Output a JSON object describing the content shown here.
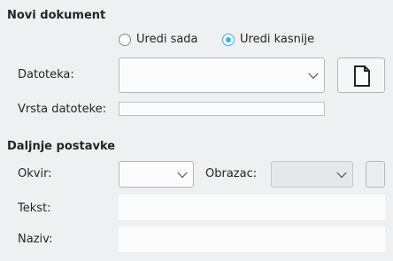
{
  "sections": {
    "new_document": "Novi dokument",
    "further_settings": "Daljnje postavke"
  },
  "radios": {
    "edit_now": {
      "label": "Uredi sada",
      "checked": false
    },
    "edit_later": {
      "label": "Uredi kasnije",
      "checked": true
    }
  },
  "fields": {
    "file_label": "Datoteka:",
    "file_value": "",
    "file_type_label": "Vrsta datoteke:",
    "file_type_value": "",
    "frame_label": "Okvir:",
    "frame_value": "",
    "style_label": "Obrazac:",
    "style_value": "",
    "text_label": "Tekst:",
    "text_value": "",
    "name_label": "Naziv:",
    "name_value": ""
  },
  "icons": {
    "new_file_button": "new-document-icon"
  }
}
